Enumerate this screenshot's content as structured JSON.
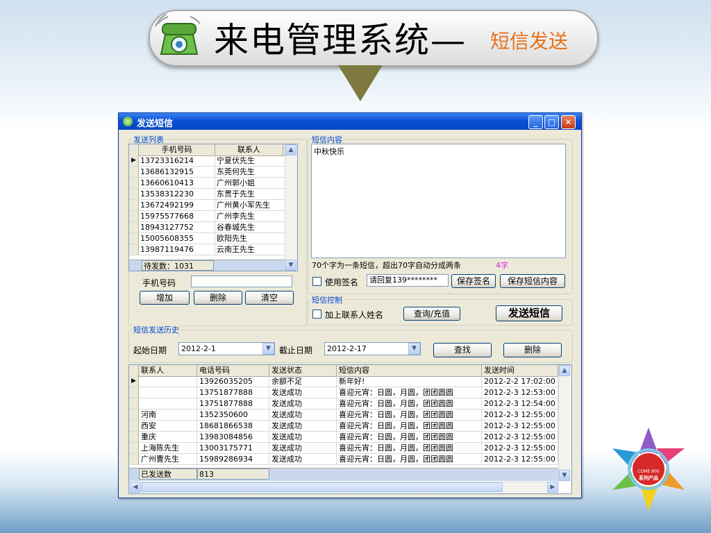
{
  "banner": {
    "title": "来电管理系统—",
    "subtitle": "短信发送"
  },
  "window": {
    "title": "发送短信"
  },
  "send_list": {
    "group_label": "发送列表",
    "columns": [
      "手机号码",
      "联系人"
    ],
    "rows": [
      [
        "13723316214",
        "宁夏伏先生"
      ],
      [
        "13686132915",
        "东莞何先生"
      ],
      [
        "13660610413",
        "广州郭小姐"
      ],
      [
        "13538312230",
        "东贯于先生"
      ],
      [
        "13672492199",
        "广州黄小军先生"
      ],
      [
        "15975577668",
        "广州李先生"
      ],
      [
        "18943127752",
        "谷春城先生"
      ],
      [
        "15005608355",
        "欧阳先生"
      ],
      [
        "13987119476",
        "云南王先生"
      ]
    ],
    "pending_label": "待发数：1031",
    "phone_label": "手机号码",
    "phone_value": "",
    "add_label": "增加",
    "delete_label": "删除",
    "clear_label": "清空"
  },
  "sms_content": {
    "group_label": "短信内容",
    "text": "中秋快乐",
    "hint": "70个字为一条短信，超出70字自动分成两条",
    "count": "4字",
    "use_signature_label": "使用签名",
    "signature_value": "请回复139********",
    "save_signature_label": "保存签名",
    "save_content_label": "保存短信内容"
  },
  "sms_control": {
    "group_label": "短信控制",
    "add_name_label": "加上联系人姓名",
    "query_label": "查询/充值",
    "send_label": "发送短信"
  },
  "history": {
    "group_label": "短信发送历史",
    "start_label": "起始日期",
    "start_value": "2012-2-1",
    "end_label": "截止日期",
    "end_value": "2012-2-17",
    "search_label": "查找",
    "delete_label": "删除",
    "columns": [
      "联系人",
      "电话号码",
      "发送状态",
      "短信内容",
      "发送时间"
    ],
    "rows": [
      [
        "",
        "13926035205",
        "余额不足",
        "新年好!",
        "2012-2-2 17:02:00"
      ],
      [
        "",
        "13751877888",
        "发送成功",
        "喜迎元宵：日圆，月圆，团团圆圆",
        "2012-2-3 12:53:00"
      ],
      [
        "",
        "13751877888",
        "发送成功",
        "喜迎元宵：日圆，月圆，团团圆圆",
        "2012-2-3 12:54:00"
      ],
      [
        "河南",
        "1352350600",
        "发送成功",
        "喜迎元宵：日圆，月圆，团团圆圆",
        "2012-2-3 12:55:00"
      ],
      [
        "西安",
        "18681866538",
        "发送成功",
        "喜迎元宵：日圆，月圆，团团圆圆",
        "2012-2-3 12:55:00"
      ],
      [
        "重庆",
        "13983084856",
        "发送成功",
        "喜迎元宵：日圆，月圆，团团圆圆",
        "2012-2-3 12:55:00"
      ],
      [
        "上海陈先生",
        "13003175771",
        "发送成功",
        "喜迎元宵：日圆，月圆，团团圆圆",
        "2012-2-3 12:55:00"
      ],
      [
        "广州曹先生",
        "15989286934",
        "发送成功",
        "喜迎元宵：日圆，月圆，团团圆圆",
        "2012-2-3 12:55:00"
      ]
    ],
    "sent_label": "已发送数",
    "sent_value": "813"
  },
  "logo": {
    "center_text": "COME 800",
    "center_sub": "系列产品"
  },
  "colors": {
    "accent": "#0046d5",
    "titlebar": "#0a4fd6",
    "banner_sub": "#e8701a",
    "count": "#e020e0"
  }
}
